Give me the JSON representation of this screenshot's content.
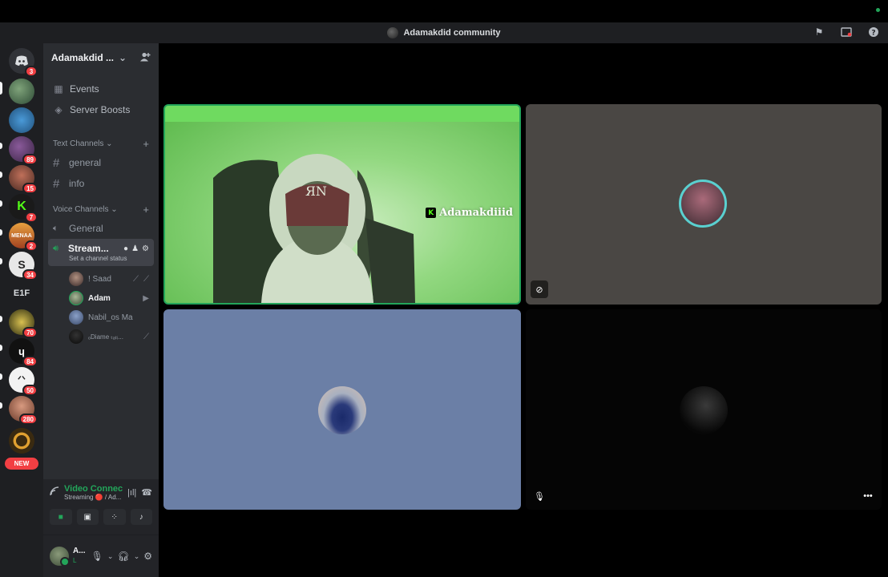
{
  "window": {
    "title": "Adamakdid community"
  },
  "rail": {
    "servers": [
      {
        "name": "discord-home",
        "badge": "3"
      },
      {
        "name": "server-1",
        "badge": ""
      },
      {
        "name": "server-2",
        "badge": ""
      },
      {
        "name": "server-3",
        "badge": "89"
      },
      {
        "name": "server-4",
        "badge": "15"
      },
      {
        "name": "server-5",
        "badge": "7"
      },
      {
        "name": "server-6",
        "badge": "2"
      },
      {
        "name": "server-7",
        "badge": "34"
      },
      {
        "name": "server-e1f",
        "label": "E1F",
        "badge": ""
      },
      {
        "name": "server-8",
        "badge": "70"
      },
      {
        "name": "server-9",
        "badge": "84"
      },
      {
        "name": "server-10",
        "badge": "50"
      },
      {
        "name": "server-11",
        "badge": "280"
      },
      {
        "name": "server-12",
        "badge": ""
      }
    ],
    "new_label": "NEW"
  },
  "sidebar": {
    "server_name": "Adamakdid ...",
    "nav": [
      {
        "label": "Events"
      },
      {
        "label": "Server Boosts"
      }
    ],
    "text_category": "Text Channels",
    "text_channels": [
      "general",
      "info"
    ],
    "voice_category": "Voice Channels",
    "voice_channels": [
      "General"
    ],
    "active_channel": {
      "name": "Stream...",
      "status": "Set a channel status"
    },
    "voice_users": [
      {
        "name": "! Saad"
      },
      {
        "name": "Adam"
      },
      {
        "name": "Nabil_os Ma"
      },
      {
        "name": "ₒDiame ₜₐₜᵢ..."
      }
    ]
  },
  "voice_panel": {
    "title": "Video Connecte",
    "subtitle": "Streaming 🔴 / Ad..."
  },
  "user_panel": {
    "name": "A...",
    "status": "L"
  },
  "stage": {
    "stream_name": "Adamakdiiid",
    "stream_badge": "K"
  },
  "colors": {
    "accent_green": "#23a55a",
    "badge_red": "#f23f43",
    "tile_gray": "#4a4744",
    "tile_blue": "#6b7fa6"
  }
}
